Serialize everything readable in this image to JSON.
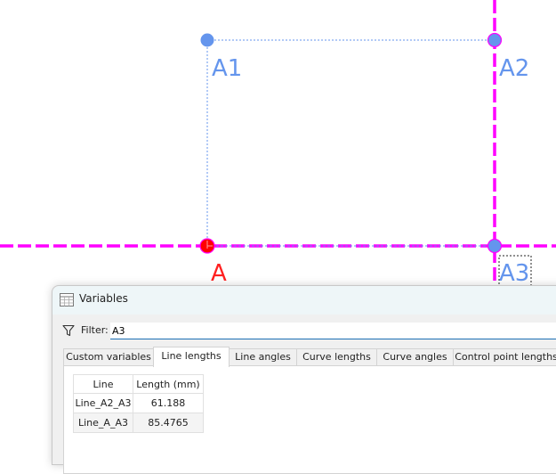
{
  "canvas": {
    "colors": {
      "magenta_line": "#ff00ff",
      "blue_point": "#6495ed",
      "red_point": "#ff0000",
      "blue_label": "#6495ed",
      "red_label": "#ff2020"
    },
    "points": [
      {
        "name": "A1",
        "label": "A1",
        "color": "#6495ed"
      },
      {
        "name": "A2",
        "label": "A2",
        "color": "#6495ed"
      },
      {
        "name": "A",
        "label": "A",
        "color": "#ff2020"
      },
      {
        "name": "A3",
        "label": "A3",
        "color": "#6495ed"
      }
    ]
  },
  "dialog": {
    "title": "Variables",
    "title_icon": "table-icon",
    "filter": {
      "label": "Filter:",
      "value": "A3",
      "icon": "funnel-icon"
    },
    "tabs": [
      {
        "label": "Custom variables",
        "active": false
      },
      {
        "label": "Line lengths",
        "active": true
      },
      {
        "label": "Line angles",
        "active": false
      },
      {
        "label": "Curve lengths",
        "active": false
      },
      {
        "label": "Curve angles",
        "active": false
      },
      {
        "label": "Control point lengths",
        "active": false
      }
    ],
    "table": {
      "headers": [
        "Line",
        "Length (mm)"
      ],
      "rows": [
        [
          "Line_A2_A3",
          "61.188"
        ],
        [
          "Line_A_A3",
          "85.4765"
        ]
      ]
    }
  }
}
